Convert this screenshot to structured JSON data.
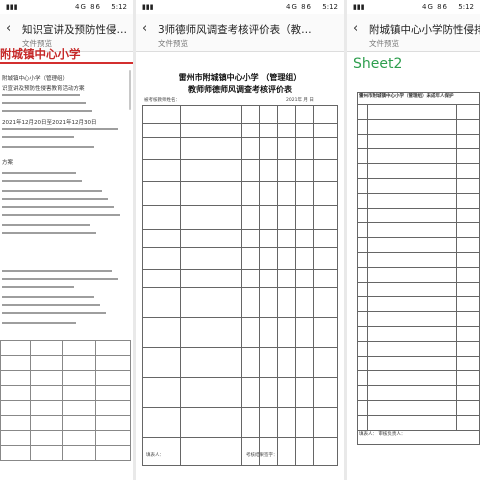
{
  "screens": [
    {
      "status": {
        "time": "5:12",
        "icons": "4G 86"
      },
      "nav": {
        "back": "‹",
        "title": "知识宣讲及预防性侵…",
        "subtitle": "文件预览"
      },
      "doc": {
        "heading": "附城镇中心小学",
        "lines": [
          "附城镇中心小学（管理组）",
          "识宣讲及预防性侵害教育活动方案",
          "2021年12月20日至2021年12月30日",
          "方案"
        ]
      }
    },
    {
      "status": {
        "time": "5:12",
        "icons": "4G 86"
      },
      "nav": {
        "back": "‹",
        "title": "3师德师风调查考核评价表（教…",
        "subtitle": "文件预览"
      },
      "doc": {
        "title_line1": "雷州市附城镇中心小学 （管理组）",
        "title_line2": "教师师德师风调查考核评价表",
        "meta_left": "被考核教师姓名：",
        "meta_right": "2021年 月 日",
        "footer_left": "填表人：",
        "footer_right": "考核结果签字："
      }
    },
    {
      "status": {
        "time": "5:12",
        "icons": "4G 86"
      },
      "nav": {
        "back": "‹",
        "title": "附城镇中心小学防性侵排…",
        "subtitle": "文件预览"
      },
      "doc": {
        "sheet": "Sheet2",
        "header": "雷州市附城镇中心小学（管理组）未成年人保护",
        "footer_row": "填表人：    审核负责人："
      }
    }
  ]
}
